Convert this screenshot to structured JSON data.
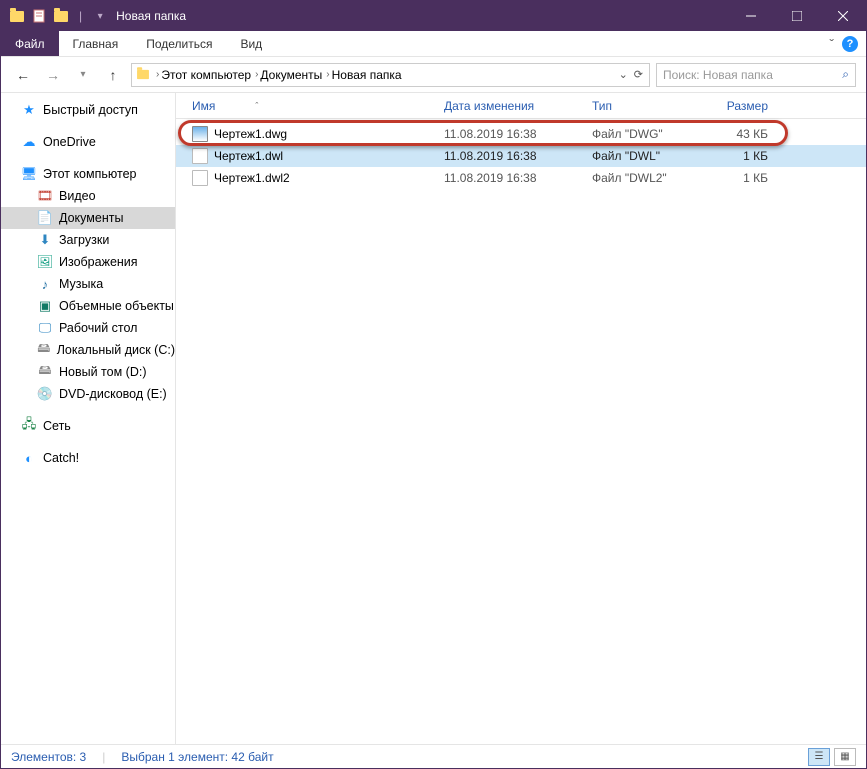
{
  "titlebar": {
    "title": "Новая папка",
    "separator": "|"
  },
  "ribbon": {
    "file": "Файл",
    "home": "Главная",
    "share": "Поделиться",
    "view": "Вид",
    "expand": "ˇ",
    "help": "?"
  },
  "nav": {
    "breadcrumb": [
      {
        "label": "Этот компьютер"
      },
      {
        "label": "Документы"
      },
      {
        "label": "Новая папка"
      }
    ],
    "search_placeholder": "Поиск: Новая папка"
  },
  "sidebar": {
    "quick": "Быстрый доступ",
    "onedrive": "OneDrive",
    "pc": "Этот компьютер",
    "children": [
      {
        "icon": "video",
        "label": "Видео"
      },
      {
        "icon": "doc",
        "label": "Документы",
        "selected": true
      },
      {
        "icon": "dl",
        "label": "Загрузки"
      },
      {
        "icon": "img",
        "label": "Изображения"
      },
      {
        "icon": "music",
        "label": "Музыка"
      },
      {
        "icon": "3d",
        "label": "Объемные объекты"
      },
      {
        "icon": "desk",
        "label": "Рабочий стол"
      },
      {
        "icon": "drive",
        "label": "Локальный диск (C:)"
      },
      {
        "icon": "drive",
        "label": "Новый том (D:)"
      },
      {
        "icon": "dvd",
        "label": "DVD-дисковод (E:)"
      }
    ],
    "network": "Сеть",
    "catch": "Catch!"
  },
  "columns": {
    "name": "Имя",
    "date": "Дата изменения",
    "type": "Тип",
    "size": "Размер",
    "sort": "ˆ"
  },
  "files": [
    {
      "icon": "dwg",
      "name": "Чертеж1.dwg",
      "date": "11.08.2019 16:38",
      "type": "Файл \"DWG\"",
      "size": "43 КБ",
      "highlighted": true
    },
    {
      "icon": "blank",
      "name": "Чертеж1.dwl",
      "date": "11.08.2019 16:38",
      "type": "Файл \"DWL\"",
      "size": "1 КБ",
      "selected": true
    },
    {
      "icon": "blank",
      "name": "Чертеж1.dwl2",
      "date": "11.08.2019 16:38",
      "type": "Файл \"DWL2\"",
      "size": "1 КБ"
    }
  ],
  "status": {
    "items": "Элементов: 3",
    "selection": "Выбран 1 элемент: 42 байт"
  }
}
